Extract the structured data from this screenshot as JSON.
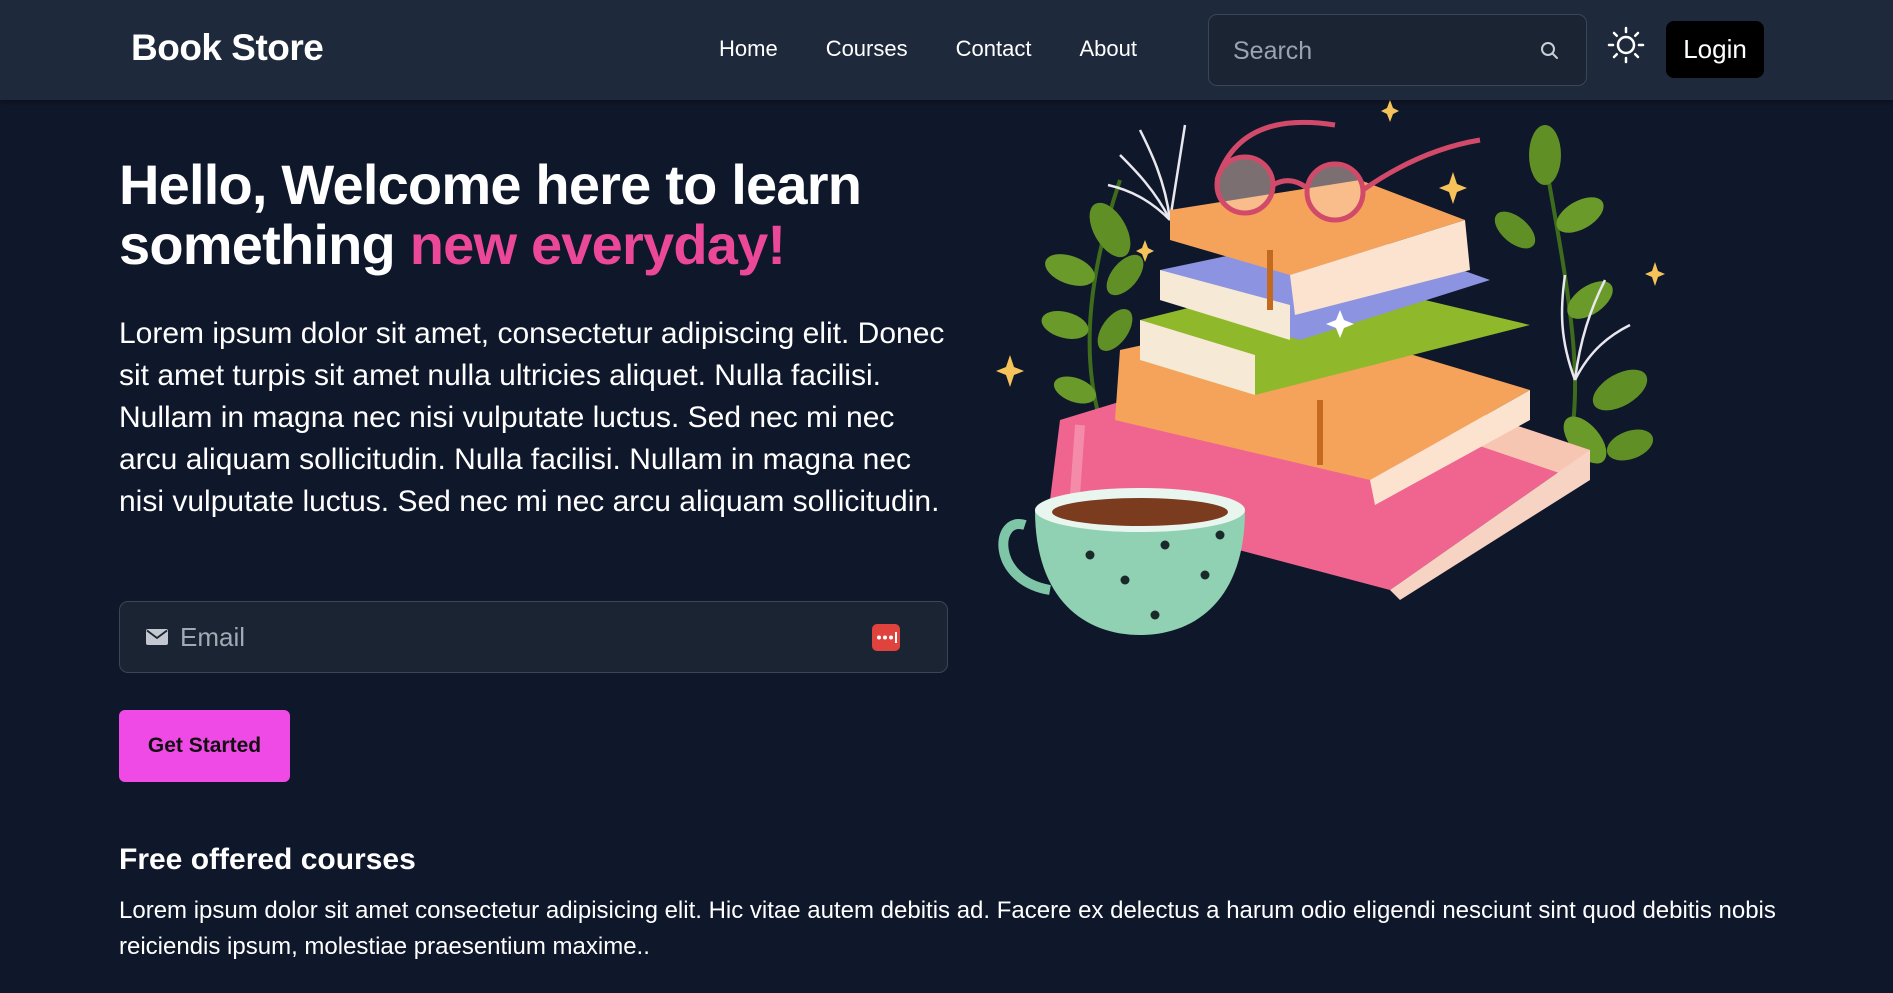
{
  "navbar": {
    "brand": "Book Store",
    "links": [
      {
        "label": "Home"
      },
      {
        "label": "Courses"
      },
      {
        "label": "Contact"
      },
      {
        "label": "About"
      }
    ],
    "search": {
      "placeholder": "Search",
      "value": ""
    },
    "login_label": "Login",
    "icons": {
      "search": "search-icon",
      "theme": "sun-icon"
    }
  },
  "hero": {
    "title_main": "Hello, Welcome here to learn something ",
    "title_accent": "new everyday!",
    "description": "Lorem ipsum dolor sit amet, consectetur adipiscing elit. Donec sit amet turpis sit amet nulla ultricies aliquet. Nulla facilisi. Nullam in magna nec nisi vulputate luctus. Sed nec mi nec arcu aliquam sollicitudin. Nulla facilisi. Nullam in magna nec nisi vulputate luctus. Sed nec mi nec arcu aliquam sollicitudin.",
    "email": {
      "placeholder": "Email",
      "value": ""
    },
    "cta_label": "Get Started",
    "illustration": "stack-of-books-with-glasses-and-teacup"
  },
  "courses": {
    "title": "Free offered courses",
    "description": "Lorem ipsum dolor sit amet consectetur adipisicing elit. Hic vitae autem debitis ad. Facere ex delectus a harum odio eligendi nesciunt sint quod debitis nobis reiciendis ipsum, molestiae praesentium maxime.."
  },
  "colors": {
    "page_bg": "#0f172a",
    "navbar_bg": "#1e293b",
    "accent_text": "#ec4899",
    "cta_bg": "#f04ae6",
    "login_bg": "#000000"
  }
}
